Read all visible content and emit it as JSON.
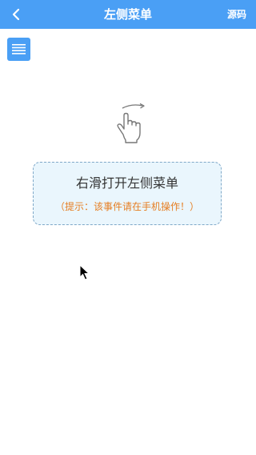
{
  "header": {
    "title": "左侧菜单",
    "source_label": "源码",
    "back_icon": "chevron-left-icon"
  },
  "menu_button": {
    "icon": "hamburger-menu-icon"
  },
  "gesture": {
    "icon": "swipe-right-hand-icon"
  },
  "hint": {
    "title": "右滑打开左侧菜单",
    "note": "（提示：该事件请在手机操作！）"
  },
  "colors": {
    "primary": "#4a9ff5",
    "hint_background": "#eaf6fd",
    "hint_border": "#7fa8c8",
    "note_text": "#e67e22"
  }
}
